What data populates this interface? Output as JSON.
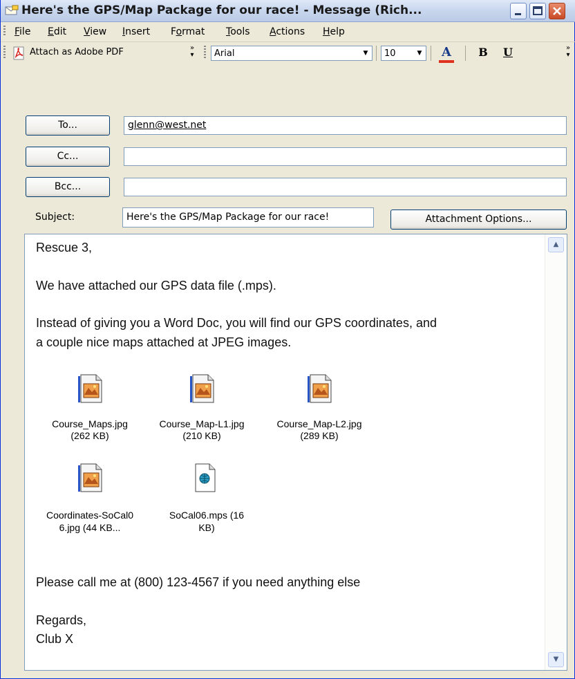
{
  "window": {
    "title": "Here's the GPS/Map Package for our race! - Message (Rich...",
    "controls": [
      "minimize",
      "maximize",
      "close"
    ]
  },
  "menu": {
    "items": [
      "File",
      "Edit",
      "View",
      "Insert",
      "Format",
      "Tools",
      "Actions",
      "Help"
    ]
  },
  "toolbar": {
    "attach_pdf_label": "Attach as Adobe PDF",
    "font_name": "Arial",
    "font_size": "10",
    "font_color_glyph": "A",
    "bold_glyph": "B",
    "underline_glyph": "U"
  },
  "header": {
    "to_label": "To...",
    "to_value": "glenn@west.net",
    "cc_label": "Cc...",
    "cc_value": "",
    "bcc_label": "Bcc...",
    "bcc_value": "",
    "subject_label": "Subject:",
    "subject_value": "Here's the GPS/Map Package for our race!",
    "attachment_options_label": "Attachment Options..."
  },
  "body": {
    "greeting": "Rescue 3,",
    "line1": "We have attached our GPS data file (.mps).",
    "line2a": "Instead of giving you a Word Doc, you will find our GPS coordinates, and",
    "line2b": "a couple nice maps attached at JPEG images.",
    "line3": "Please call me at (800) 123-4567 if you need anything else",
    "closing": "Regards,",
    "signature": "Club X"
  },
  "attachments": [
    {
      "name": "Course_Maps.jpg",
      "size": "(262 KB)",
      "icon": "jpeg-image-icon"
    },
    {
      "name": "Course_Map-L1.jpg",
      "size": "(210 KB)",
      "icon": "jpeg-image-icon"
    },
    {
      "name": "Course_Map-L2.jpg",
      "size": "(289 KB)",
      "icon": "jpeg-image-icon"
    },
    {
      "name": "Coordinates-SoCal0",
      "size": "6.jpg (44 KB...",
      "icon": "jpeg-image-icon"
    },
    {
      "name": "SoCal06.mps (16",
      "size": "KB)",
      "icon": "mps-file-icon"
    }
  ],
  "colors": {
    "titlebar": "#c9d7ee",
    "face": "#ece9d8",
    "field_border": "#7f9db9",
    "font_color_underline": "#e0301e"
  }
}
